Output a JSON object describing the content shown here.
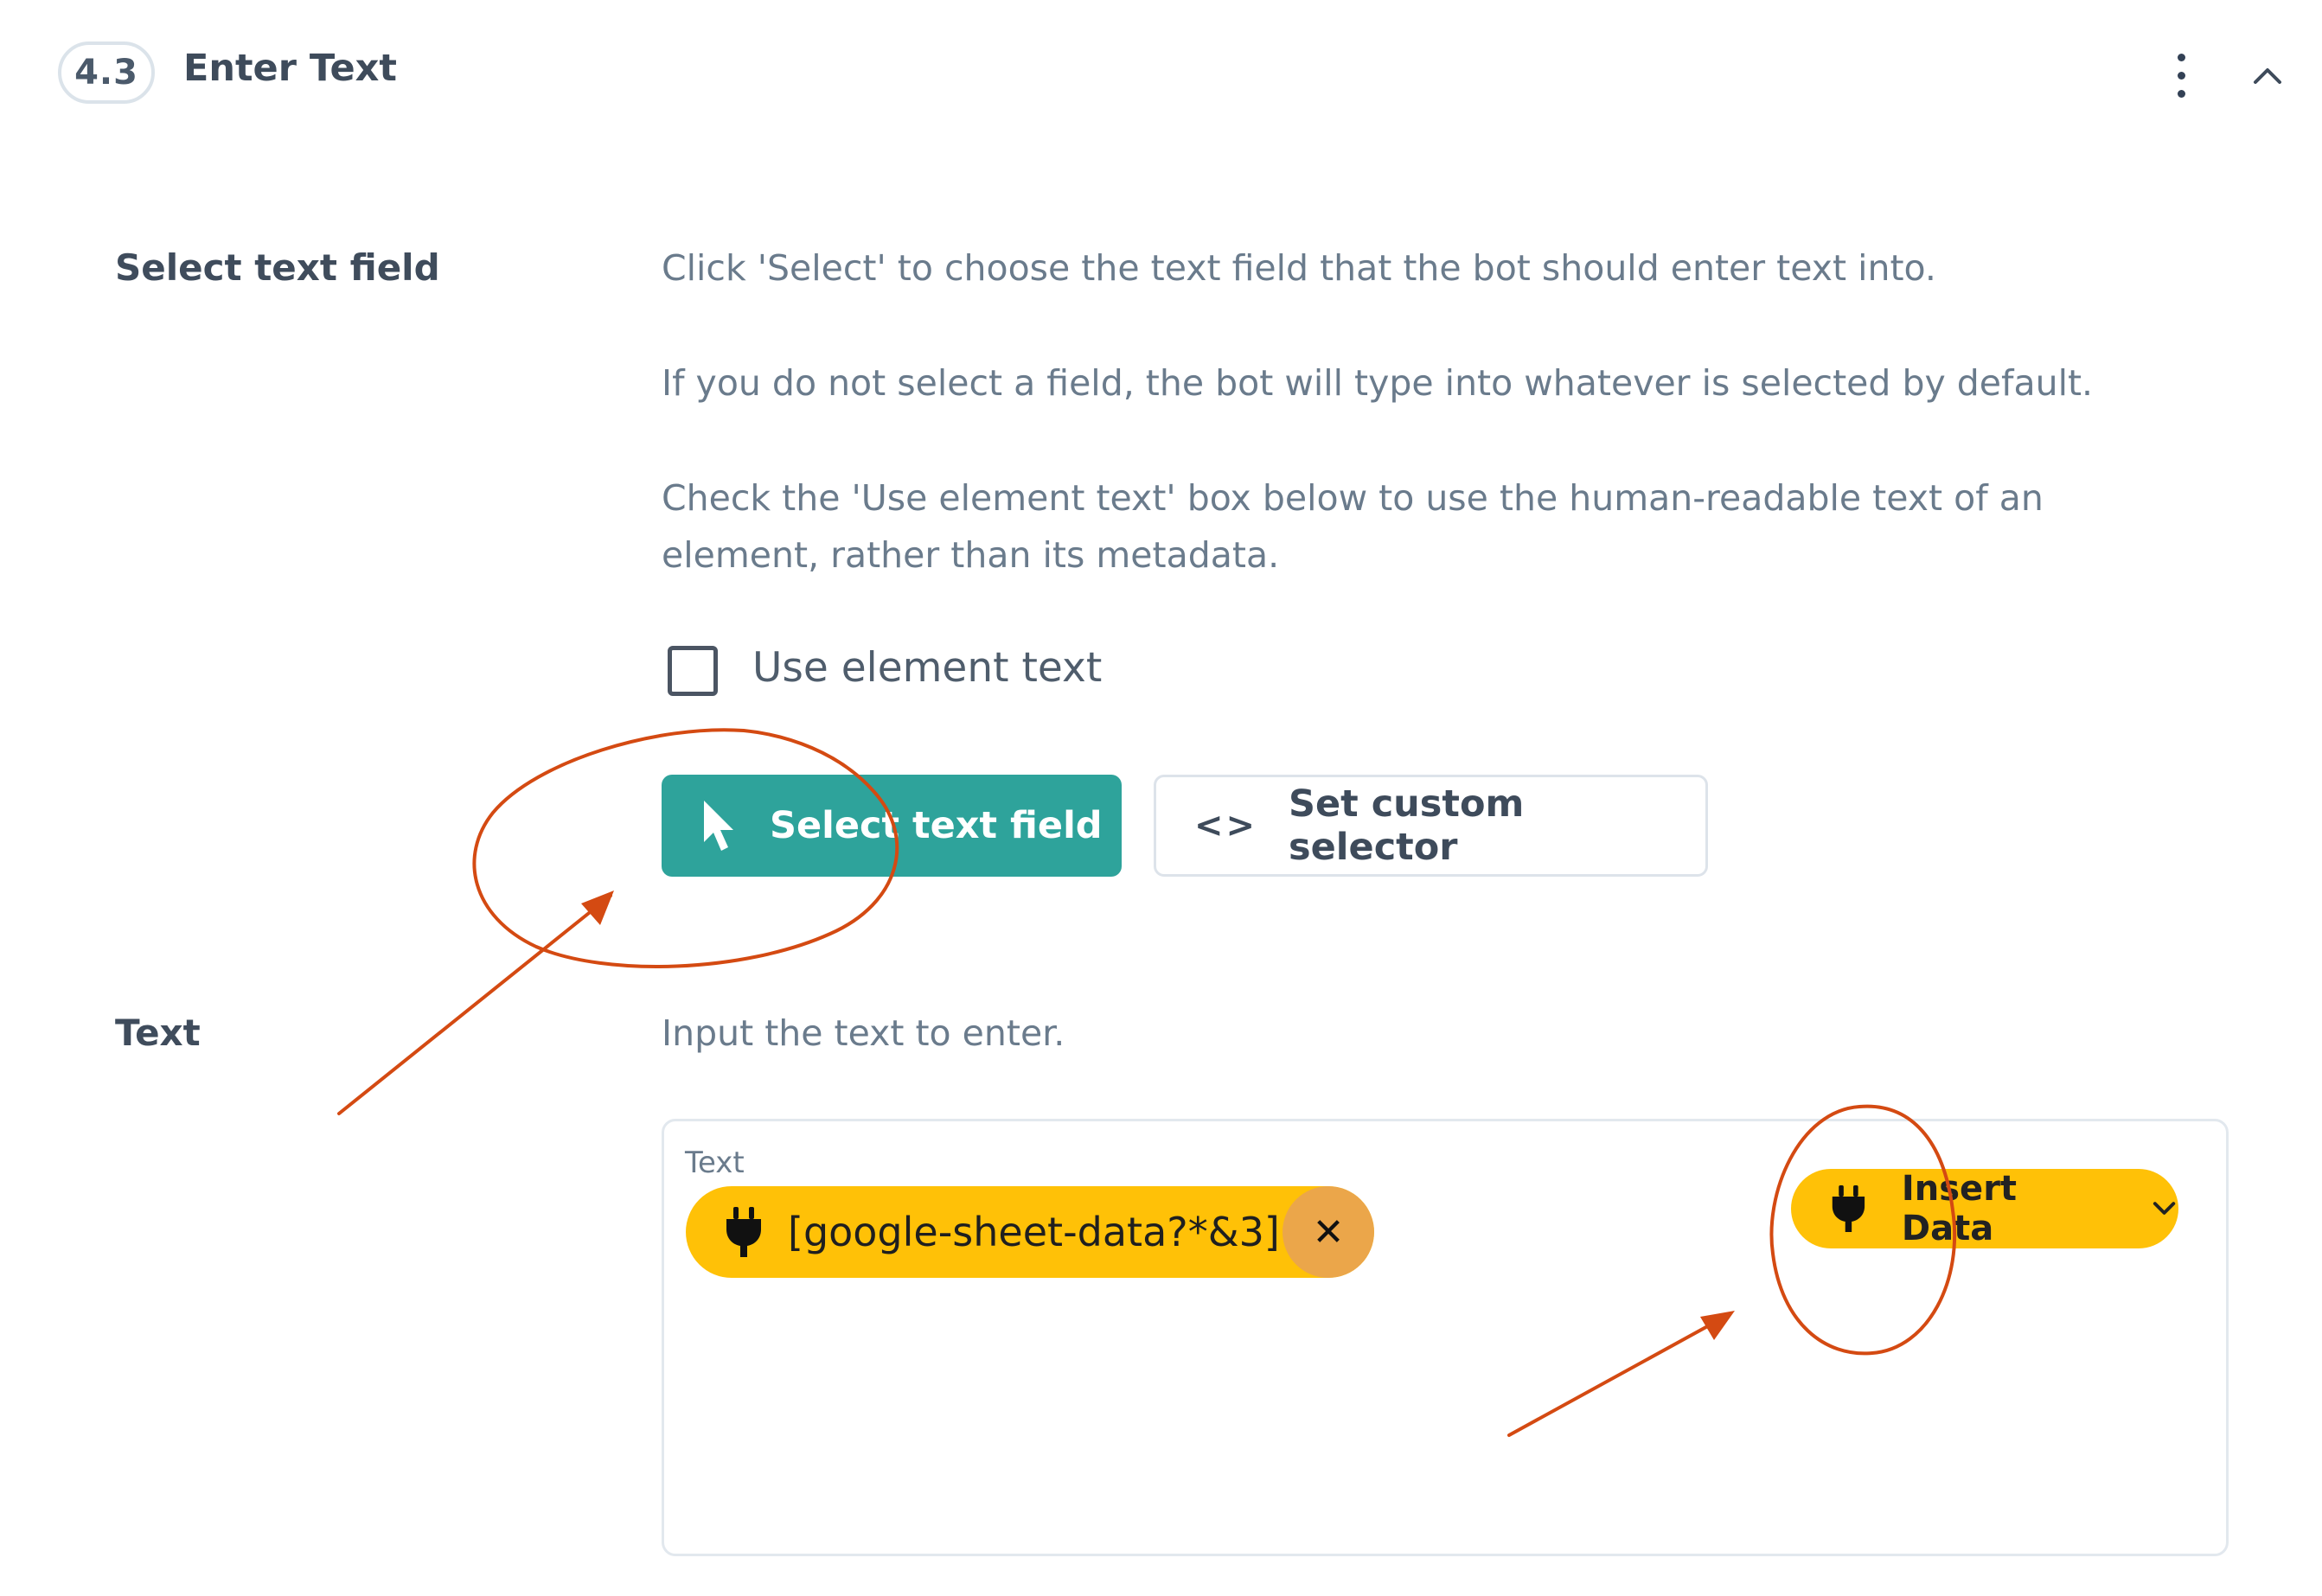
{
  "header": {
    "step_number": "4.3",
    "step_title": "Enter Text"
  },
  "select_field": {
    "label": "Select text field",
    "help_1": "Click 'Select' to choose the text field that the bot should enter text into.",
    "help_2": "If you do not select a field, the bot will type into whatever is selected by default.",
    "help_3_line1": "Check the 'Use element text' box below to use the human-readable text of an",
    "help_3_line2": "element, rather than its metadata.",
    "checkbox_label": "Use element text",
    "checkbox_checked": false,
    "primary_button": "Select text field",
    "secondary_button": "Set custom selector",
    "secondary_icon": "<>"
  },
  "text_section": {
    "label": "Text",
    "help": "Input the text to enter.",
    "field_label": "Text",
    "chip_text": "[google-sheet-data?*&3]",
    "chip_close": "✕",
    "insert_button": "Insert Data"
  },
  "colors": {
    "primary": "#2ea39b",
    "chip": "#ffc107",
    "chip_close": "#eba64a",
    "annotation": "#d44a12"
  },
  "icons": [
    "kebab-menu-icon",
    "chevron-up-icon",
    "cursor-pointer-icon",
    "code-icon",
    "plug-icon",
    "close-icon",
    "chevron-down-icon"
  ]
}
